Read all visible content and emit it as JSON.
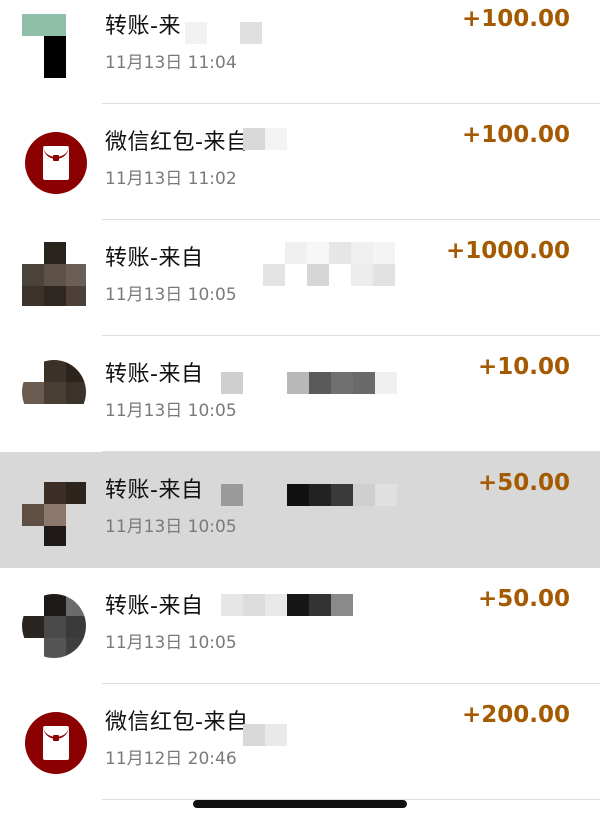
{
  "colors": {
    "amount": "#a45a00",
    "red_packet": "#8b0000",
    "highlight_row": "#d8d8d8",
    "divider": "#dedede",
    "time_text": "#7a7a7a"
  },
  "transactions": [
    {
      "title": "转账-来",
      "time": "11月13日 11:04",
      "amount": "+100.00",
      "icon": "user-avatar-pixelated",
      "highlighted": false
    },
    {
      "title": "微信红包-来自",
      "time": "11月13日 11:02",
      "amount": "+100.00",
      "icon": "red-packet-icon",
      "highlighted": false
    },
    {
      "title": "转账-来自",
      "time": "11月13日 10:05",
      "amount": "+1000.00",
      "icon": "user-avatar-pixelated",
      "highlighted": false
    },
    {
      "title": "转账-来自",
      "time": "11月13日 10:05",
      "amount": "+10.00",
      "icon": "user-avatar-pixelated",
      "highlighted": false
    },
    {
      "title": "转账-来自",
      "time": "11月13日 10:05",
      "amount": "+50.00",
      "icon": "user-avatar-pixelated",
      "highlighted": true
    },
    {
      "title": "转账-来自",
      "time": "11月13日 10:05",
      "amount": "+50.00",
      "icon": "user-avatar-pixelated",
      "highlighted": false
    },
    {
      "title": "微信红包-来自",
      "time": "11月12日 20:46",
      "amount": "+200.00",
      "icon": "red-packet-icon",
      "highlighted": false
    }
  ]
}
